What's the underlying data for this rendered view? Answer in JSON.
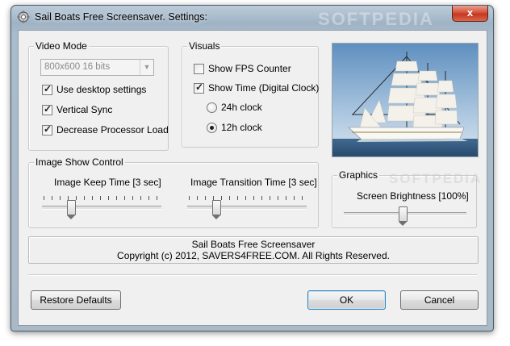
{
  "window": {
    "title": "Sail Boats Free Screensaver. Settings:",
    "close_glyph": "x"
  },
  "video_mode": {
    "label": "Video Mode",
    "resolution": "800x600 16 bits",
    "checkboxes": [
      {
        "label": "Use desktop settings",
        "checked": true
      },
      {
        "label": "Vertical Sync",
        "checked": true
      },
      {
        "label": "Decrease Processor Load",
        "checked": true
      }
    ]
  },
  "visuals": {
    "label": "Visuals",
    "show_fps": {
      "label": "Show FPS Counter",
      "checked": false
    },
    "show_time": {
      "label": "Show Time (Digital Clock)",
      "checked": true
    },
    "clock_24h": {
      "label": "24h clock",
      "selected": false
    },
    "clock_12h": {
      "label": "12h clock",
      "selected": true
    }
  },
  "image_show": {
    "label": "Image Show Control",
    "keep_time": {
      "label": "Image Keep Time [3 sec]",
      "value": 3
    },
    "transition_time": {
      "label": "Image Transition Time [3 sec]",
      "value": 3
    }
  },
  "graphics": {
    "label": "Graphics",
    "brightness": {
      "label": "Screen Brightness [100%]",
      "percent": 100
    }
  },
  "info": {
    "line1": "Sail Boats Free Screensaver",
    "line2": "Copyright (c) 2012, SAVERS4FREE.COM. All Rights Reserved."
  },
  "buttons": {
    "restore": "Restore Defaults",
    "ok": "OK",
    "cancel": "Cancel"
  },
  "watermarks": {
    "top": "SOFTPEDIA",
    "mid": "SOFTPEDIA"
  },
  "colors": {
    "titlebar": "#a9bccd",
    "client": "#f0f0f0",
    "close": "#c5371f",
    "ok_border": "#3c7fb1"
  },
  "icons": {
    "app": "screensaver-gear-icon",
    "close": "close-icon",
    "dropdown": "chevron-down-icon",
    "check": "checkmark-icon"
  }
}
